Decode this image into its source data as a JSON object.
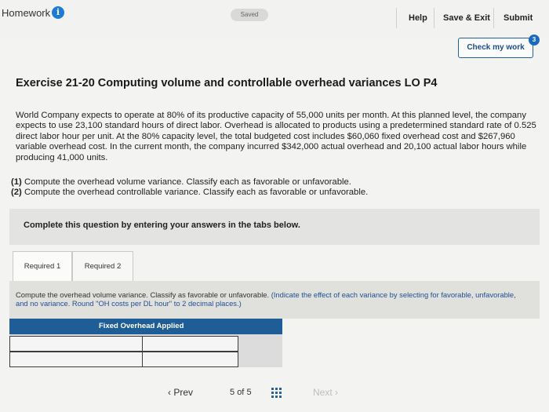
{
  "header": {
    "title": "Homework",
    "saved": "Saved",
    "help": "Help",
    "save_exit": "Save & Exit",
    "submit": "Submit",
    "check_work": "Check my work",
    "check_count": "3"
  },
  "exercise": {
    "title": "Exercise 21-20 Computing volume and controllable overhead variances LO P4",
    "body": "World Company expects to operate at 80% of its productive capacity of 55,000 units per month. At this planned level, the company expects to use 23,100 standard hours of direct labor. Overhead is allocated to products using a predetermined standard rate of 0.525 direct labor hour per unit. At the 80% capacity level, the total budgeted cost includes $60,060 fixed overhead cost and $267,960 variable overhead cost. In the current month, the company incurred $342,000 actual overhead and 20,100 actual labor hours while producing 41,000 units.",
    "req1_num": "(1)",
    "req1_text": "Compute the overhead volume variance. Classify each as favorable or unfavorable.",
    "req2_num": "(2)",
    "req2_text": "Compute the overhead controllable variance. Classify each as favorable or unfavorable."
  },
  "complete_panel": "Complete this question by entering your answers in the tabs below.",
  "tabs": [
    "Required 1",
    "Required 2"
  ],
  "instructions": {
    "main": "Compute the overhead volume variance. Classify as favorable or unfavorable.",
    "note": "(Indicate the effect of each variance by selecting for favorable, unfavorable, and no variance. Round \"OH costs per DL hour\" to 2 decimal places.)"
  },
  "table": {
    "header": "Fixed Overhead Applied"
  },
  "pagination": {
    "prev": "Prev",
    "page": "5",
    "of": "of",
    "total": "5",
    "next": "Next"
  }
}
